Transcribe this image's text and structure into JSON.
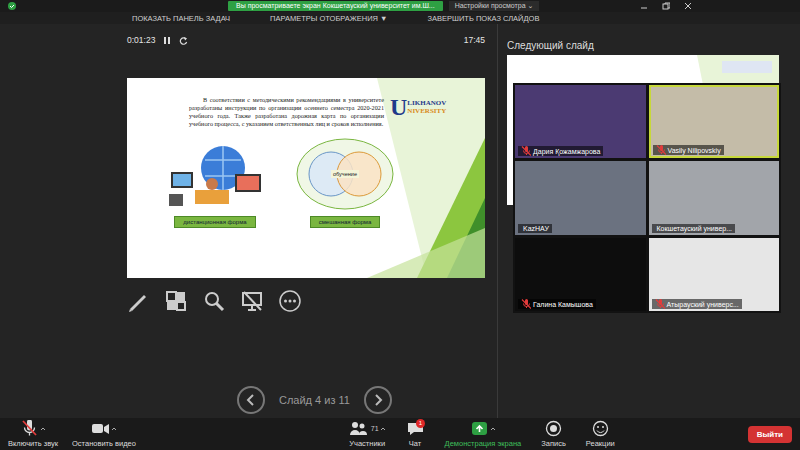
{
  "banner": {
    "text": "Вы просматриваете экран Кокшетауский университет им.Ш...",
    "settings": "Настройки просмотра",
    "settings_caret": "⌄"
  },
  "slideshow_bar": [
    "ПОКАЗАТЬ ПАНЕЛЬ ЗАДАЧ",
    "ПАРАМЕТРЫ ОТОБРАЖЕНИЯ ▼",
    "ЗАВЕРШИТЬ ПОКАЗ СЛАЙДОВ"
  ],
  "presenter": {
    "timer": "0:01:23",
    "clock": "17:45",
    "next_label": "Следующий слайд",
    "slide_counter": "Слайд 4 из 11"
  },
  "slide": {
    "paragraph": "В соответствии с методическими рекомендациями в университете разработаны инструкции по организации осеннего семестра 2020-2021 учебного года. Также разработана дорожная карта по организации учебного процесса, с указанием ответственных лиц и сроков исполнения.",
    "logo": {
      "initial": "U",
      "line1": "LIKHANOV",
      "line2": "NIVERSITY"
    },
    "figures": [
      {
        "caption": "дистанционная форма",
        "kind": "people"
      },
      {
        "caption": "смешанная форма",
        "kind": "venn",
        "inner": "обучение"
      }
    ]
  },
  "tiles": [
    {
      "name": "Дария Қожамжарова",
      "muted": true,
      "speaking": false,
      "color": "#4b3a72"
    },
    {
      "name": "Vasily Nilipovskiy",
      "muted": true,
      "speaking": true,
      "color": "#c4bca8"
    },
    {
      "name": "KazНАУ",
      "muted": false,
      "speaking": false,
      "color": "#6b7280"
    },
    {
      "name": "Кокшетауский универ...",
      "muted": false,
      "speaking": false,
      "color": "#a2a5aa"
    },
    {
      "name": "Галина Камышова",
      "muted": true,
      "speaking": false,
      "color": "#0d0d0d"
    },
    {
      "name": "Атырауский универс...",
      "muted": true,
      "speaking": false,
      "color": "#e6e6e6"
    }
  ],
  "toolbar": {
    "left": [
      {
        "label": "Включить звук",
        "kind": "mic",
        "muted": true
      },
      {
        "label": "Остановить видео",
        "kind": "video"
      }
    ],
    "center": [
      {
        "label": "Участники",
        "kind": "participants",
        "count": "71"
      },
      {
        "label": "Чат",
        "kind": "chat",
        "badge": "1"
      },
      {
        "label": "Демонстрация экрана",
        "kind": "share",
        "active": true
      },
      {
        "label": "Запись",
        "kind": "record"
      },
      {
        "label": "Реакции",
        "kind": "reactions"
      }
    ],
    "leave": "Выйти"
  }
}
